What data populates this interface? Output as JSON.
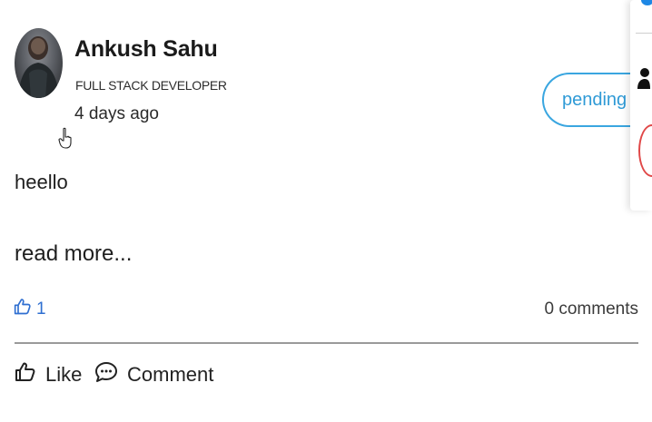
{
  "post": {
    "author": {
      "name": "Ankush Sahu",
      "title": "FULL STACK DEVELOPER",
      "avatar_icon": "user-avatar-photo"
    },
    "time_ago": "4 days ago",
    "status": "pending",
    "body": "heello",
    "read_more_label": "read more...",
    "likes": "1",
    "comments": "0 comments",
    "actions": {
      "like_label": "Like",
      "comment_label": "Comment"
    }
  },
  "colors": {
    "accent": "#2f9ad6",
    "like_icon": "#2f6fd1",
    "danger": "#e04848"
  },
  "icons": {
    "like": "thumbs-up-icon",
    "comment": "comment-bubble-icon",
    "cursor": "hand-pointer-icon",
    "side_person": "person-icon"
  }
}
